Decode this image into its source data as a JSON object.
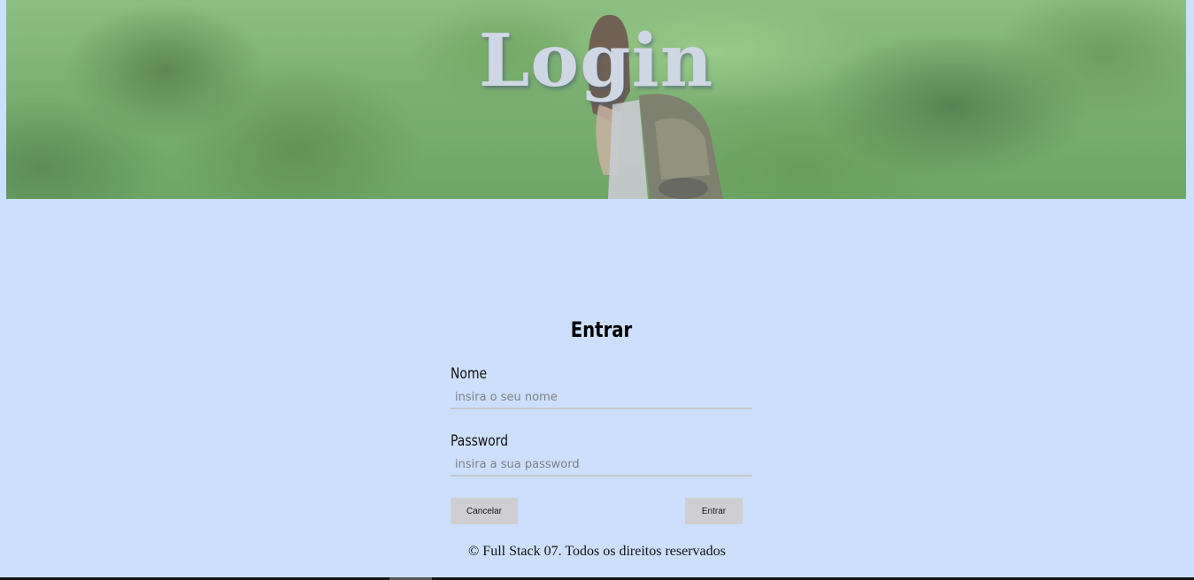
{
  "header": {
    "title": "Login"
  },
  "form": {
    "title": "Entrar",
    "name_label": "Nome",
    "name_placeholder": "insira o seu nome",
    "password_label": "Password",
    "password_placeholder": "insira a sua password",
    "cancel_label": "Cancelar",
    "submit_label": "Entrar"
  },
  "footer": {
    "text": "© Full Stack 07. Todos os direitos reservados"
  },
  "colors": {
    "page_background": "#cce0fd",
    "button_background": "#cfcfd3",
    "header_title": "#cfd6e4"
  }
}
